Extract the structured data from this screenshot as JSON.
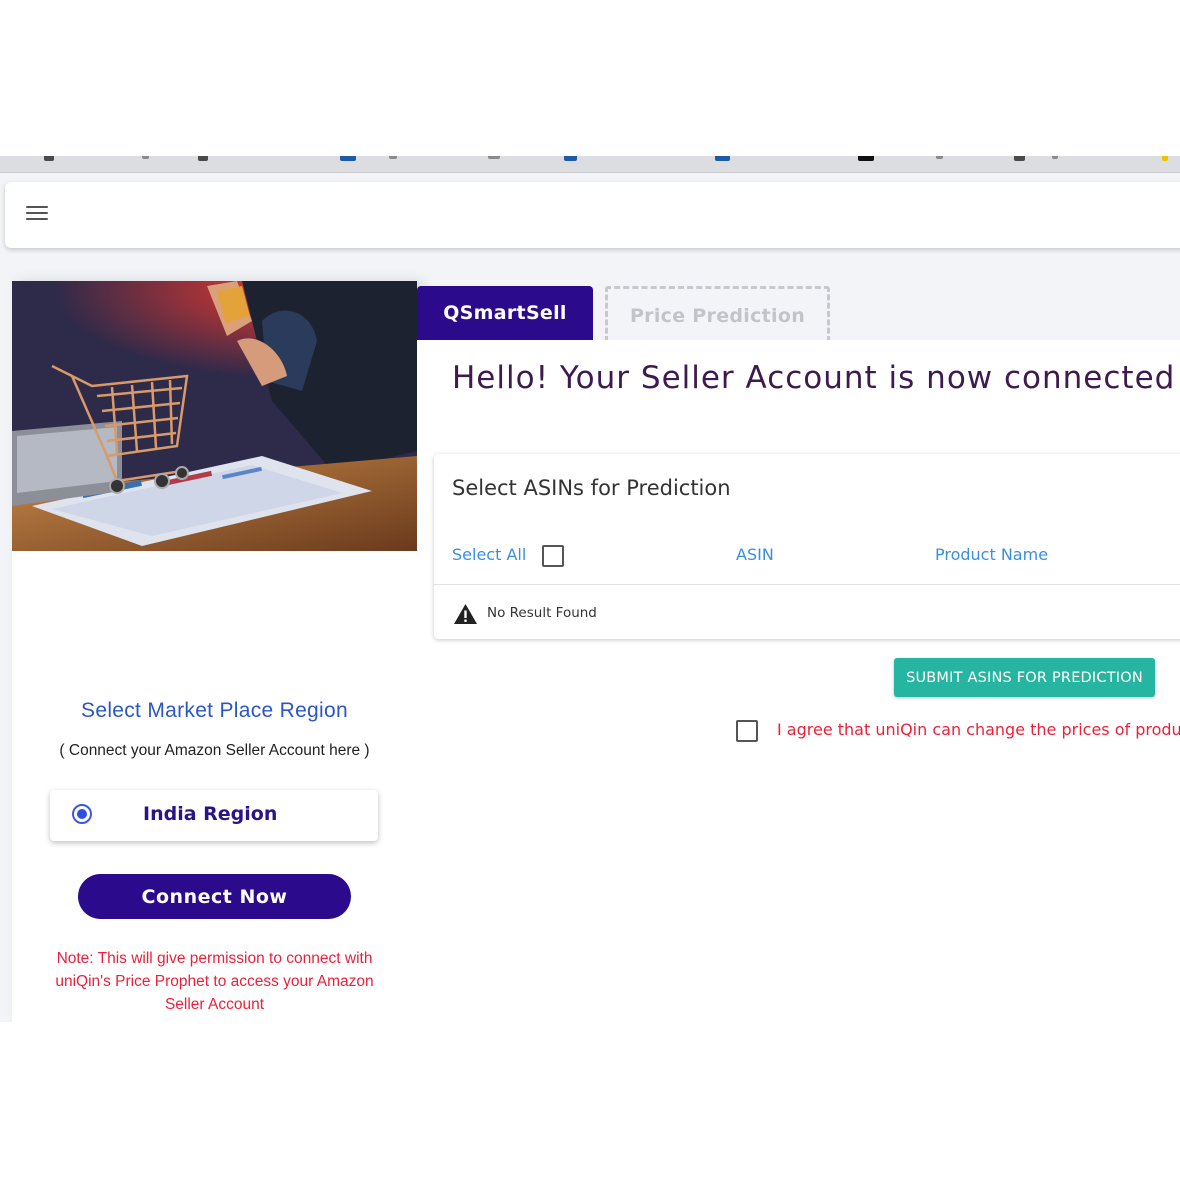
{
  "header": {
    "menu_icon": "hamburger-menu-icon"
  },
  "left_panel": {
    "region_title": "Select Market Place Region",
    "region_subtitle": "( Connect your Amazon Seller Account here )",
    "region_option": {
      "label": "India Region",
      "selected": true
    },
    "connect_button": "Connect Now",
    "note": "Note: This will give permission to connect with uniQin's Price Prophet to access your Amazon Seller Account"
  },
  "tabs": [
    {
      "label": "QSmartSell",
      "active": true
    },
    {
      "label": "Price Prediction",
      "active": false
    }
  ],
  "main": {
    "greeting": "Hello! Your Seller Account is now connected",
    "asin_card": {
      "title": "Select ASINs for Prediction",
      "select_all_label": "Select All",
      "columns": [
        "ASIN",
        "Product Name"
      ],
      "empty_message": "No Result Found"
    },
    "submit_button": "SUBMIT ASINS FOR PREDICTION",
    "agree_text": "I agree that uniQin can change the prices of product"
  },
  "colors": {
    "brand_primary": "#2c0a8c",
    "link_blue": "#3a8fe0",
    "accent_teal": "#26b5a0",
    "warning_red": "#ee1f3a"
  }
}
